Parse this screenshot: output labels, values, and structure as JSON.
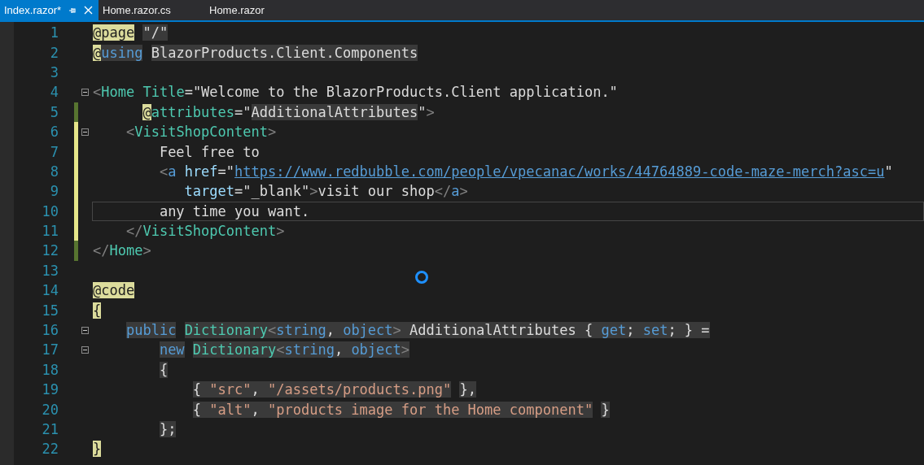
{
  "tabs": [
    {
      "label": "Index.razor*",
      "selected": true
    },
    {
      "label": "Home.razor.cs",
      "selected": false
    },
    {
      "label": "Home.razor",
      "selected": false
    }
  ],
  "editor": {
    "lines": [
      {
        "number": "1",
        "fold": false,
        "saved_change": false,
        "unsaved_change": false,
        "current": false,
        "tokens": [
          {
            "text": "@page",
            "kind": "razor",
            "shaded": false
          },
          {
            "text": " \"/\"",
            "kind": "plain",
            "shaded": true
          }
        ]
      },
      {
        "number": "2",
        "fold": false,
        "saved_change": false,
        "unsaved_change": false,
        "current": false,
        "tokens": [
          {
            "text": "@",
            "kind": "razor",
            "shaded": false
          },
          {
            "text": "using",
            "kind": "keyword",
            "shaded": true
          },
          {
            "text": " BlazorProducts.Client.Components",
            "kind": "plain",
            "shaded": true
          }
        ]
      },
      {
        "number": "3",
        "fold": false,
        "saved_change": false,
        "unsaved_change": false,
        "current": false
      },
      {
        "number": "4",
        "fold": true,
        "saved_change": false,
        "unsaved_change": false,
        "current": false,
        "tokens": [
          {
            "text": "<",
            "kind": "punct",
            "shaded": false
          },
          {
            "text": "Home",
            "kind": "tag",
            "shaded": false
          },
          {
            "text": " Title",
            "kind": "tag",
            "shaded": false
          },
          {
            "text": "=\"Welcome to the BlazorProducts.Client application.\"",
            "kind": "plain",
            "shaded": false
          }
        ]
      },
      {
        "number": "5",
        "fold": false,
        "saved_change": true,
        "unsaved_change": false,
        "current": false,
        "tokens": [
          {
            "text": "      @",
            "kind": "razor",
            "shaded": false
          },
          {
            "text": "attributes",
            "kind": "tag",
            "shaded": false
          },
          {
            "text": "=\"",
            "kind": "plain",
            "shaded": false
          },
          {
            "text": "AdditionalAttributes",
            "kind": "plain",
            "shaded": true
          },
          {
            "text": "\"",
            "kind": "plain",
            "shaded": false
          },
          {
            "text": ">",
            "kind": "punct",
            "shaded": false
          }
        ]
      },
      {
        "number": "6",
        "fold": true,
        "saved_change": false,
        "unsaved_change": true,
        "current": false,
        "tokens": [
          {
            "text": "    <",
            "kind": "punct",
            "shaded": false
          },
          {
            "text": "VisitShopContent",
            "kind": "tag",
            "shaded": false
          },
          {
            "text": ">",
            "kind": "punct",
            "shaded": false
          }
        ]
      },
      {
        "number": "7",
        "fold": false,
        "saved_change": false,
        "unsaved_change": true,
        "current": false,
        "tokens": [
          {
            "text": "        Feel free to",
            "kind": "plain",
            "shaded": false
          }
        ]
      },
      {
        "number": "8",
        "fold": false,
        "saved_change": false,
        "unsaved_change": true,
        "current": false,
        "tokens": [
          {
            "text": "        <",
            "kind": "punct",
            "shaded": false
          },
          {
            "text": "a",
            "kind": "keyword",
            "shaded": false
          },
          {
            "text": " href",
            "kind": "attr",
            "shaded": false
          },
          {
            "text": "=\"",
            "kind": "plain",
            "shaded": false
          },
          {
            "text": "https://www.redbubble.com/people/vpecanac/works/44764889-code-maze-merch?asc=u",
            "kind": "link",
            "shaded": false
          },
          {
            "text": "\"",
            "kind": "plain",
            "shaded": false
          }
        ]
      },
      {
        "number": "9",
        "fold": false,
        "saved_change": false,
        "unsaved_change": true,
        "current": false,
        "tokens": [
          {
            "text": "           target",
            "kind": "attr",
            "shaded": false
          },
          {
            "text": "=\"_blank\"",
            "kind": "plain",
            "shaded": false
          },
          {
            "text": ">",
            "kind": "punct",
            "shaded": false
          },
          {
            "text": "visit our shop",
            "kind": "plain",
            "shaded": false
          },
          {
            "text": "</",
            "kind": "punct",
            "shaded": false
          },
          {
            "text": "a",
            "kind": "keyword",
            "shaded": false
          },
          {
            "text": ">",
            "kind": "punct",
            "shaded": false
          }
        ]
      },
      {
        "number": "10",
        "fold": false,
        "saved_change": false,
        "unsaved_change": true,
        "current": true,
        "tokens": [
          {
            "text": "        any time you want.",
            "kind": "plain",
            "shaded": false
          }
        ]
      },
      {
        "number": "11",
        "fold": false,
        "saved_change": false,
        "unsaved_change": true,
        "current": false,
        "tokens": [
          {
            "text": "    </",
            "kind": "punct",
            "shaded": false
          },
          {
            "text": "VisitShopContent",
            "kind": "tag",
            "shaded": false
          },
          {
            "text": ">",
            "kind": "punct",
            "shaded": false
          }
        ]
      },
      {
        "number": "12",
        "fold": false,
        "saved_change": true,
        "unsaved_change": false,
        "current": false,
        "tokens": [
          {
            "text": "</",
            "kind": "punct",
            "shaded": false
          },
          {
            "text": "Home",
            "kind": "tag",
            "shaded": false
          },
          {
            "text": ">",
            "kind": "punct",
            "shaded": false
          }
        ]
      },
      {
        "number": "13",
        "fold": false,
        "saved_change": false,
        "unsaved_change": false,
        "current": false
      },
      {
        "number": "14",
        "fold": false,
        "saved_change": false,
        "unsaved_change": false,
        "current": false,
        "tokens": [
          {
            "text": "@code",
            "kind": "razor",
            "shaded": false
          }
        ]
      },
      {
        "number": "15",
        "fold": false,
        "saved_change": false,
        "unsaved_change": false,
        "current": false,
        "tokens": [
          {
            "text": "{",
            "kind": "razor",
            "shaded": false
          }
        ]
      },
      {
        "number": "16",
        "fold": true,
        "saved_change": false,
        "unsaved_change": false,
        "current": false,
        "tokens": [
          {
            "text": "    public",
            "kind": "keyword",
            "shaded": true
          },
          {
            "text": " Dictionary",
            "kind": "type",
            "shaded": true
          },
          {
            "text": "<",
            "kind": "punct",
            "shaded": true
          },
          {
            "text": "string",
            "kind": "keyword",
            "shaded": true
          },
          {
            "text": ", ",
            "kind": "plain",
            "shaded": true
          },
          {
            "text": "object",
            "kind": "keyword",
            "shaded": true
          },
          {
            "text": "> ",
            "kind": "punct",
            "shaded": true
          },
          {
            "text": "AdditionalAttributes { ",
            "kind": "plain",
            "shaded": true
          },
          {
            "text": "get",
            "kind": "keyword",
            "shaded": true
          },
          {
            "text": "; ",
            "kind": "plain",
            "shaded": true
          },
          {
            "text": "set",
            "kind": "keyword",
            "shaded": true
          },
          {
            "text": "; } =",
            "kind": "plain",
            "shaded": true
          }
        ]
      },
      {
        "number": "17",
        "fold": true,
        "saved_change": false,
        "unsaved_change": false,
        "current": false,
        "tokens": [
          {
            "text": "        new",
            "kind": "keyword",
            "shaded": true
          },
          {
            "text": " Dictionary",
            "kind": "type",
            "shaded": true
          },
          {
            "text": "<",
            "kind": "punct",
            "shaded": true
          },
          {
            "text": "string",
            "kind": "keyword",
            "shaded": true
          },
          {
            "text": ", ",
            "kind": "plain",
            "shaded": true
          },
          {
            "text": "object",
            "kind": "keyword",
            "shaded": true
          },
          {
            "text": ">",
            "kind": "punct",
            "shaded": true
          }
        ]
      },
      {
        "number": "18",
        "fold": false,
        "saved_change": false,
        "unsaved_change": false,
        "current": false,
        "tokens": [
          {
            "text": "        {",
            "kind": "plain",
            "shaded": true
          }
        ]
      },
      {
        "number": "19",
        "fold": false,
        "saved_change": false,
        "unsaved_change": false,
        "current": false,
        "tokens": [
          {
            "text": "            { ",
            "kind": "plain",
            "shaded": true
          },
          {
            "text": "\"src\"",
            "kind": "string",
            "shaded": true
          },
          {
            "text": ", ",
            "kind": "plain",
            "shaded": true
          },
          {
            "text": "\"/assets/products.png\"",
            "kind": "string",
            "shaded": true
          },
          {
            "text": " },",
            "kind": "plain",
            "shaded": true
          }
        ]
      },
      {
        "number": "20",
        "fold": false,
        "saved_change": false,
        "unsaved_change": false,
        "current": false,
        "tokens": [
          {
            "text": "            { ",
            "kind": "plain",
            "shaded": true
          },
          {
            "text": "\"alt\"",
            "kind": "string",
            "shaded": true
          },
          {
            "text": ", ",
            "kind": "plain",
            "shaded": true
          },
          {
            "text": "\"products image for the Home component\"",
            "kind": "string",
            "shaded": true
          },
          {
            "text": " }",
            "kind": "plain",
            "shaded": true
          }
        ]
      },
      {
        "number": "21",
        "fold": false,
        "saved_change": false,
        "unsaved_change": false,
        "current": false,
        "tokens": [
          {
            "text": "        };",
            "kind": "plain",
            "shaded": true
          }
        ]
      },
      {
        "number": "22",
        "fold": false,
        "saved_change": false,
        "unsaved_change": false,
        "current": false,
        "tokens": [
          {
            "text": "}",
            "kind": "razor",
            "shaded": false
          }
        ]
      }
    ]
  }
}
